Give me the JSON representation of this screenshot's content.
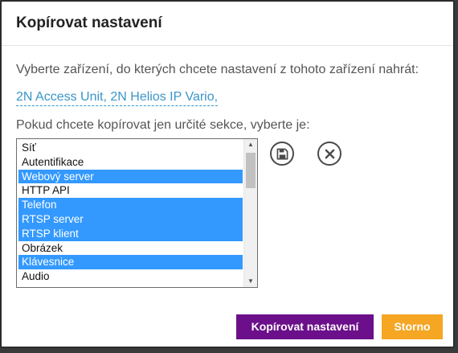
{
  "dialog": {
    "title": "Kopírovat nastavení",
    "prompt_devices": "Vyberte zařízení, do kterých chcete nastavení z tohoto zařízení nahrát:",
    "devices_link": "2N Access Unit, 2N Helios IP Vario,",
    "prompt_sections": "Pokud chcete kopírovat jen určité sekce, vyberte je:",
    "sections": [
      {
        "label": "Síť",
        "selected": false
      },
      {
        "label": "Autentifikace",
        "selected": false
      },
      {
        "label": "Webový server",
        "selected": true
      },
      {
        "label": "HTTP API",
        "selected": false
      },
      {
        "label": "Telefon",
        "selected": true
      },
      {
        "label": "RTSP server",
        "selected": true
      },
      {
        "label": "RTSP klient",
        "selected": true
      },
      {
        "label": "Obrázek",
        "selected": false
      },
      {
        "label": "Klávesnice",
        "selected": true
      },
      {
        "label": "Audio",
        "selected": false
      }
    ],
    "icons": {
      "save": "save-icon",
      "clear": "close-icon",
      "scroll_up": "scroll-up-arrow-icon",
      "scroll_down": "scroll-down-arrow-icon"
    },
    "buttons": {
      "copy_label": "Kopírovat nastavení",
      "cancel_label": "Storno"
    },
    "colors": {
      "link": "#3a95c9",
      "selection": "#3399ff",
      "primary_button": "#6b0f8a",
      "secondary_button": "#f5a623"
    }
  }
}
